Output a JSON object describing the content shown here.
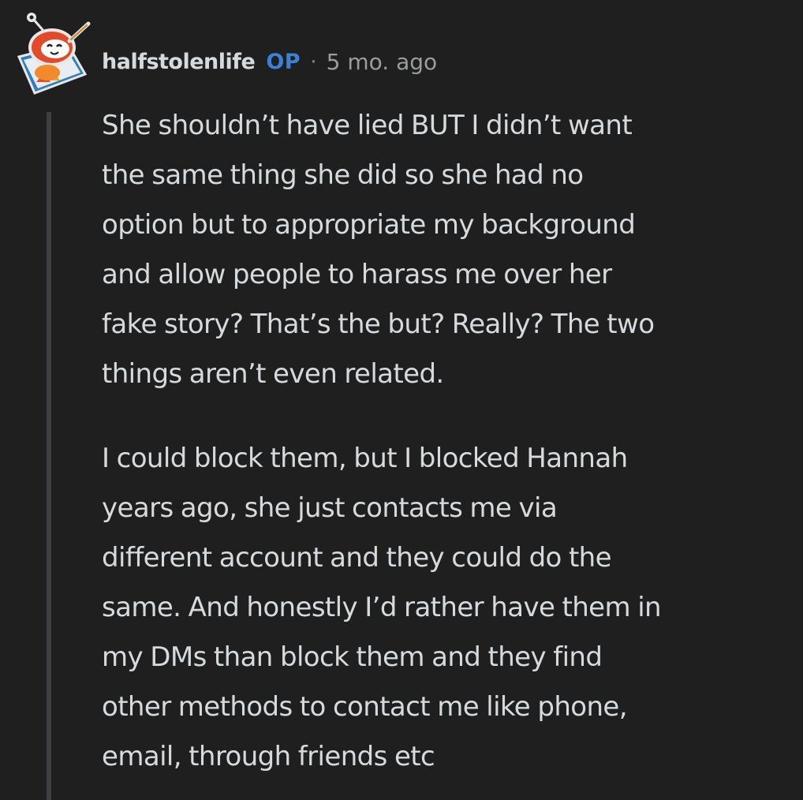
{
  "comment": {
    "author": "halfstolenlife",
    "op_badge": "OP",
    "separator": "·",
    "timestamp": "5 mo. ago",
    "avatar_icon": "reddit-snoo-avatar-icon",
    "paragraphs": [
      {
        "lines": [
          "She shouldn’t have lied BUT I didn’t want",
          "the same thing she did so she had no",
          "option but to appropriate my background",
          "and allow people to harass me over her",
          "fake story? That’s the but? Really? The two",
          "things aren’t even related."
        ]
      },
      {
        "lines": [
          "I could block them, but I blocked Hannah",
          "years ago, she just contacts me via",
          "different account and they could do the",
          "same. And honestly I’d rather have them in",
          "my DMs than block them and they find",
          "other methods to contact me like phone,",
          "email, through friends etc"
        ]
      }
    ]
  },
  "colors": {
    "background": "#1f1f20",
    "text": "#d7dadc",
    "op_badge": "#3b82d6",
    "meta": "#9a9c9e",
    "thread_line": "#3d3f41"
  }
}
